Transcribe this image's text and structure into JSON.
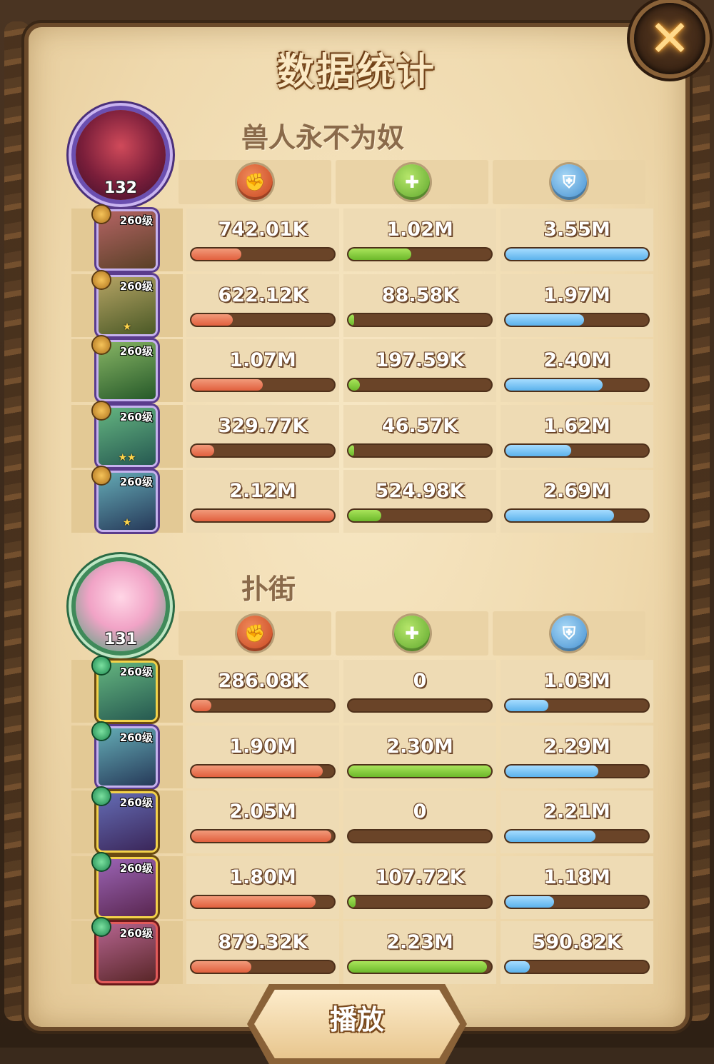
{
  "title": "数据统计",
  "close_icon": "✕",
  "play_label": "播放",
  "colors": {
    "attack": "#e2603e",
    "heal": "#6cb82a",
    "defense": "#5cb2ec"
  },
  "teams": [
    {
      "name": "兽人永不为奴",
      "avatar_level": "132",
      "heroes": [
        {
          "level": "260级",
          "stars": "",
          "damage": "742.01K",
          "damage_pct": 0.35,
          "heal": "1.02M",
          "heal_pct": 0.44,
          "defense": "3.55M",
          "defense_pct": 1.0
        },
        {
          "level": "260级",
          "stars": "★",
          "damage": "622.12K",
          "damage_pct": 0.29,
          "heal": "88.58K",
          "heal_pct": 0.04,
          "defense": "1.97M",
          "defense_pct": 0.55
        },
        {
          "level": "260级",
          "stars": "",
          "damage": "1.07M",
          "damage_pct": 0.5,
          "heal": "197.59K",
          "heal_pct": 0.08,
          "defense": "2.40M",
          "defense_pct": 0.68
        },
        {
          "level": "260级",
          "stars": "★★",
          "damage": "329.77K",
          "damage_pct": 0.16,
          "heal": "46.57K",
          "heal_pct": 0.03,
          "defense": "1.62M",
          "defense_pct": 0.46
        },
        {
          "level": "260级",
          "stars": "★",
          "damage": "2.12M",
          "damage_pct": 1.0,
          "heal": "524.98K",
          "heal_pct": 0.23,
          "defense": "2.69M",
          "defense_pct": 0.76
        }
      ]
    },
    {
      "name": "扑街",
      "avatar_level": "131",
      "heroes": [
        {
          "level": "260级",
          "stars": "",
          "damage": "286.08K",
          "damage_pct": 0.14,
          "heal": "0",
          "heal_pct": 0.0,
          "defense": "1.03M",
          "defense_pct": 0.3
        },
        {
          "level": "260级",
          "stars": "",
          "damage": "1.90M",
          "damage_pct": 0.92,
          "heal": "2.30M",
          "heal_pct": 1.0,
          "defense": "2.29M",
          "defense_pct": 0.65
        },
        {
          "level": "260级",
          "stars": "",
          "damage": "2.05M",
          "damage_pct": 0.98,
          "heal": "0",
          "heal_pct": 0.0,
          "defense": "2.21M",
          "defense_pct": 0.63
        },
        {
          "level": "260级",
          "stars": "",
          "damage": "1.80M",
          "damage_pct": 0.87,
          "heal": "107.72K",
          "heal_pct": 0.05,
          "defense": "1.18M",
          "defense_pct": 0.34
        },
        {
          "level": "260级",
          "stars": "",
          "damage": "879.32K",
          "damage_pct": 0.42,
          "heal": "2.23M",
          "heal_pct": 0.97,
          "defense": "590.82K",
          "defense_pct": 0.17
        }
      ]
    }
  ]
}
